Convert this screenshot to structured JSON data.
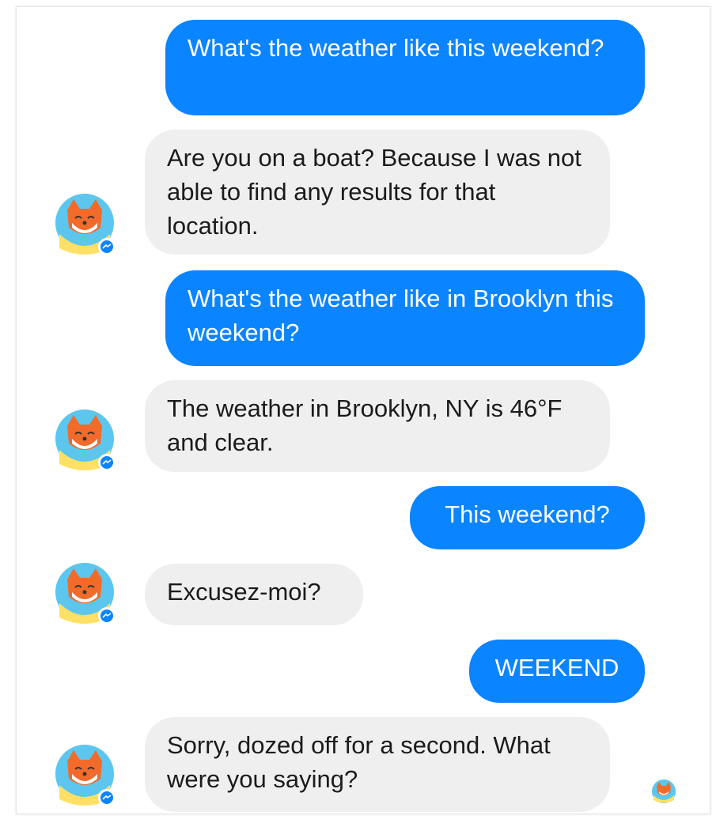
{
  "messages": [
    {
      "from": "user",
      "text": "What's the weather like this weekend?"
    },
    {
      "from": "bot",
      "text": "Are you on a boat? Because I was not able to find any results for that location."
    },
    {
      "from": "user",
      "text": "What's the weather like in Brooklyn this weekend?"
    },
    {
      "from": "bot",
      "text": "The weather in Brooklyn, NY is 46°F and clear."
    },
    {
      "from": "user",
      "text": "This weekend?"
    },
    {
      "from": "bot",
      "text": "Excusez-moi?"
    },
    {
      "from": "user",
      "text": "WEEKEND"
    },
    {
      "from": "bot",
      "text": "Sorry, dozed off for a second. What were you saying?"
    }
  ],
  "colors": {
    "outgoing_bubble": "#0b84ff",
    "incoming_bubble": "#efefef",
    "messenger_badge": "#0b84ff"
  },
  "icons": {
    "bot_avatar": "fox-bot-avatar-icon",
    "read_receipt": "fox-read-receipt-icon",
    "badge": "messenger-badge-icon"
  }
}
